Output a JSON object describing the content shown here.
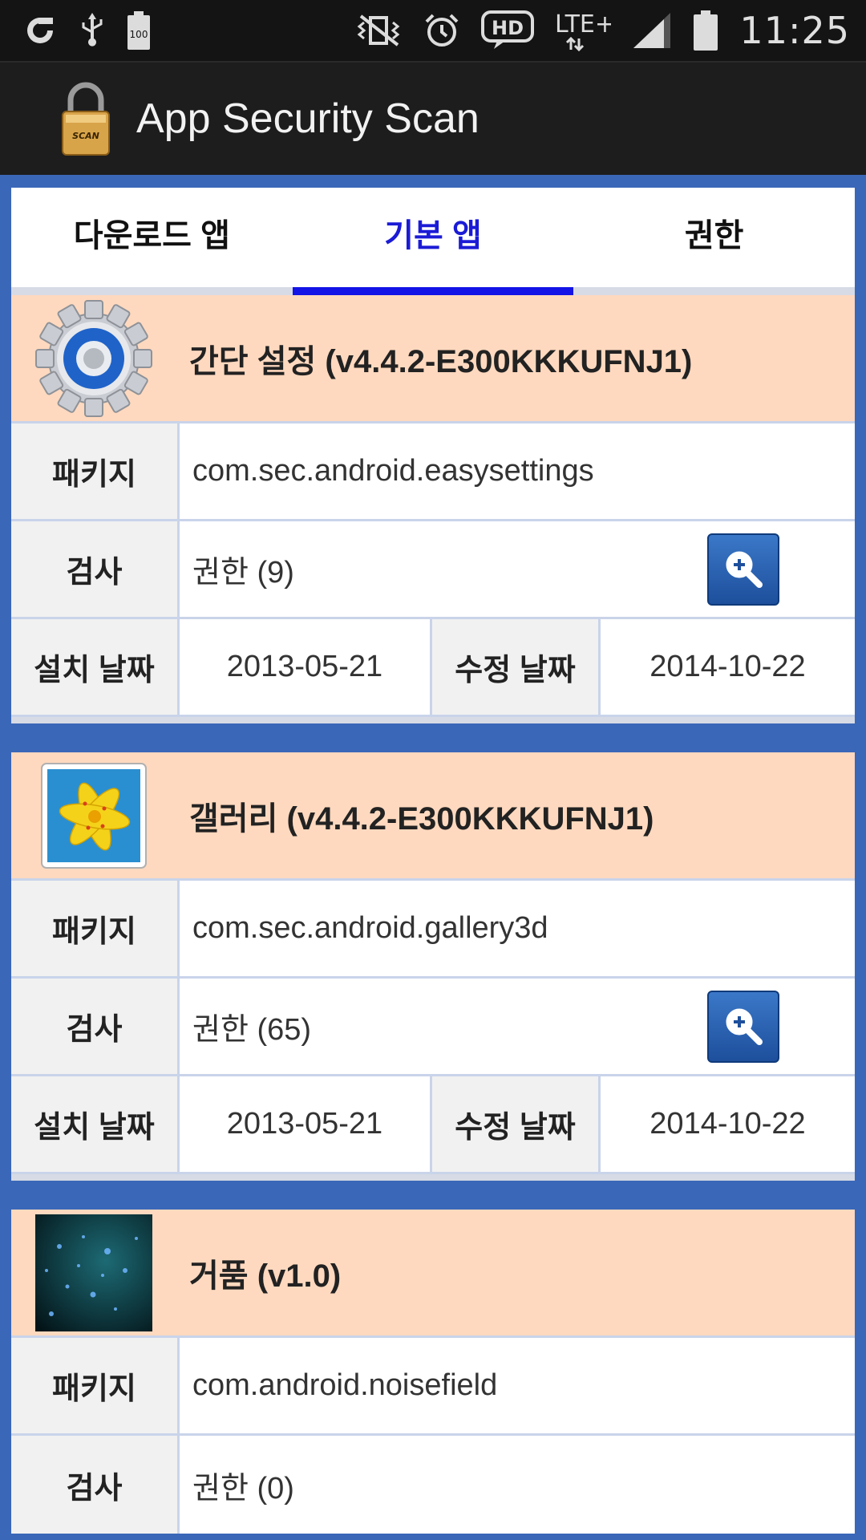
{
  "status_bar": {
    "battery_level": "100",
    "network": "LTE+",
    "hd_label": "HD",
    "time": "11:25"
  },
  "action_bar": {
    "logo_text": "SCAN",
    "title": "App Security Scan"
  },
  "tabs": [
    {
      "label": "다운로드 앱",
      "active": false
    },
    {
      "label": "기본 앱",
      "active": true
    },
    {
      "label": "권한",
      "active": false
    }
  ],
  "labels": {
    "package": "패키지",
    "scan": "검사",
    "install_date": "설치 날짜",
    "modified_date": "수정 날짜"
  },
  "apps": [
    {
      "title": "간단 설정 (v4.4.2-E300KKKUFNJ1)",
      "icon": "gear-settings-icon",
      "package": "com.sec.android.easysettings",
      "permissions": "권한 (9)",
      "install_date": "2013-05-21",
      "modified_date": "2014-10-22"
    },
    {
      "title": "갤러리 (v4.4.2-E300KKKUFNJ1)",
      "icon": "gallery-flower-icon",
      "package": "com.sec.android.gallery3d",
      "permissions": "권한 (65)",
      "install_date": "2013-05-21",
      "modified_date": "2014-10-22"
    },
    {
      "title": "거품 (v1.0)",
      "icon": "bubbles-wallpaper-icon",
      "package": "com.android.noisefield",
      "permissions": "권한 (0)"
    }
  ],
  "colors": {
    "accent_tab": "#1414e6",
    "header_bg": "#ffd9bf",
    "page_bg": "#3a67b8"
  }
}
